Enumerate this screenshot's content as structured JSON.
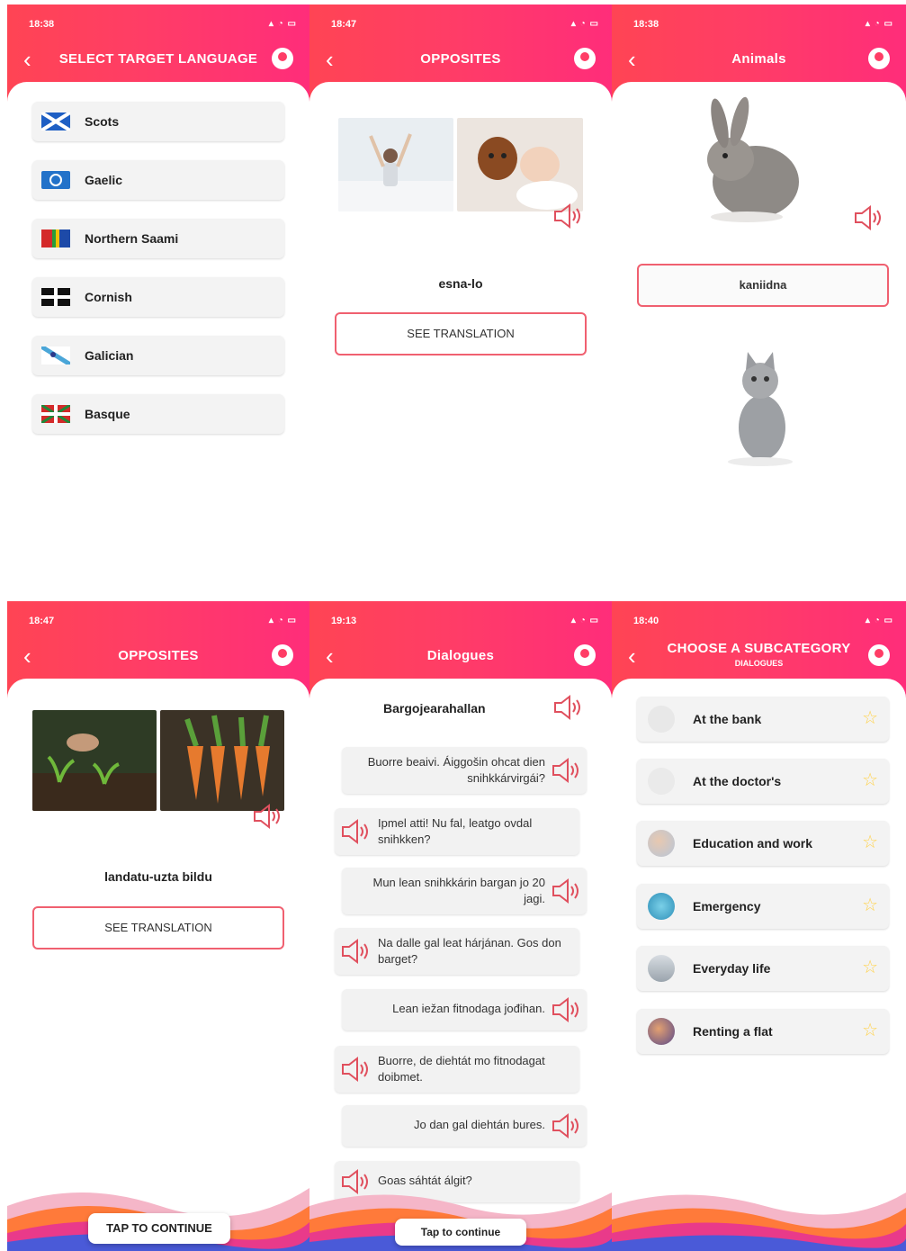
{
  "colors": {
    "header_start": "#ff4454",
    "header_end": "#ff2d7a",
    "accent": "#f06070",
    "star": "#ffd24a"
  },
  "screen1": {
    "time": "18:38",
    "title": "SELECT TARGET LANGUAGE",
    "languages": [
      {
        "label": "Scots",
        "flag": "scots-flag-icon"
      },
      {
        "label": "Gaelic",
        "flag": "gaelic-flag-icon"
      },
      {
        "label": "Northern Saami",
        "flag": "saami-flag-icon"
      },
      {
        "label": "Cornish",
        "flag": "cornish-flag-icon"
      },
      {
        "label": "Galician",
        "flag": "galician-flag-icon"
      },
      {
        "label": "Basque",
        "flag": "basque-flag-icon"
      }
    ]
  },
  "screen2": {
    "time": "18:47",
    "title": "OPPOSITES",
    "word": "esna-lo",
    "button": "SEE TRANSLATION"
  },
  "screen3": {
    "time": "18:38",
    "title": "Animals",
    "answer": "kaniidna"
  },
  "screen4": {
    "time": "18:47",
    "title": "OPPOSITES",
    "word": "landatu-uzta bildu",
    "button": "SEE TRANSLATION",
    "continue": "TAP TO CONTINUE"
  },
  "screen5": {
    "time": "19:13",
    "title": "Dialogues",
    "heading": "Bargojearahallan",
    "lines": [
      {
        "text": "Buorre beaivi. Áiggošin ohcat dien snihkkárvirgái?",
        "side": "right"
      },
      {
        "text": "Ipmel atti! Nu fal, leatgo ovdal snihkken?",
        "side": "left"
      },
      {
        "text": "Mun lean snihkkárin bargan jo 20 jagi.",
        "side": "right"
      },
      {
        "text": "Na dalle gal leat hárjánan. Gos don barget?",
        "side": "left"
      },
      {
        "text": "Lean iežan fitnodaga jođihan.",
        "side": "right"
      },
      {
        "text": "Buorre, de diehtát mo fitnodagat doibmet.",
        "side": "left"
      },
      {
        "text": "Jo dan gal diehtán bures.",
        "side": "right"
      },
      {
        "text": "Goas sáhtát álgit?",
        "side": "left"
      }
    ],
    "continue": "Tap to continue"
  },
  "screen6": {
    "time": "18:40",
    "title": "CHOOSE A SUBCATEGORY",
    "subtitle": "DIALOGUES",
    "items": [
      {
        "label": "At the bank",
        "icon": "bank-icon"
      },
      {
        "label": "At the doctor's",
        "icon": "doctor-icon"
      },
      {
        "label": "Education and work",
        "icon": "education-icon"
      },
      {
        "label": "Emergency",
        "icon": "emergency-icon"
      },
      {
        "label": "Everyday life",
        "icon": "everyday-icon"
      },
      {
        "label": "Renting a flat",
        "icon": "renting-icon"
      }
    ]
  }
}
